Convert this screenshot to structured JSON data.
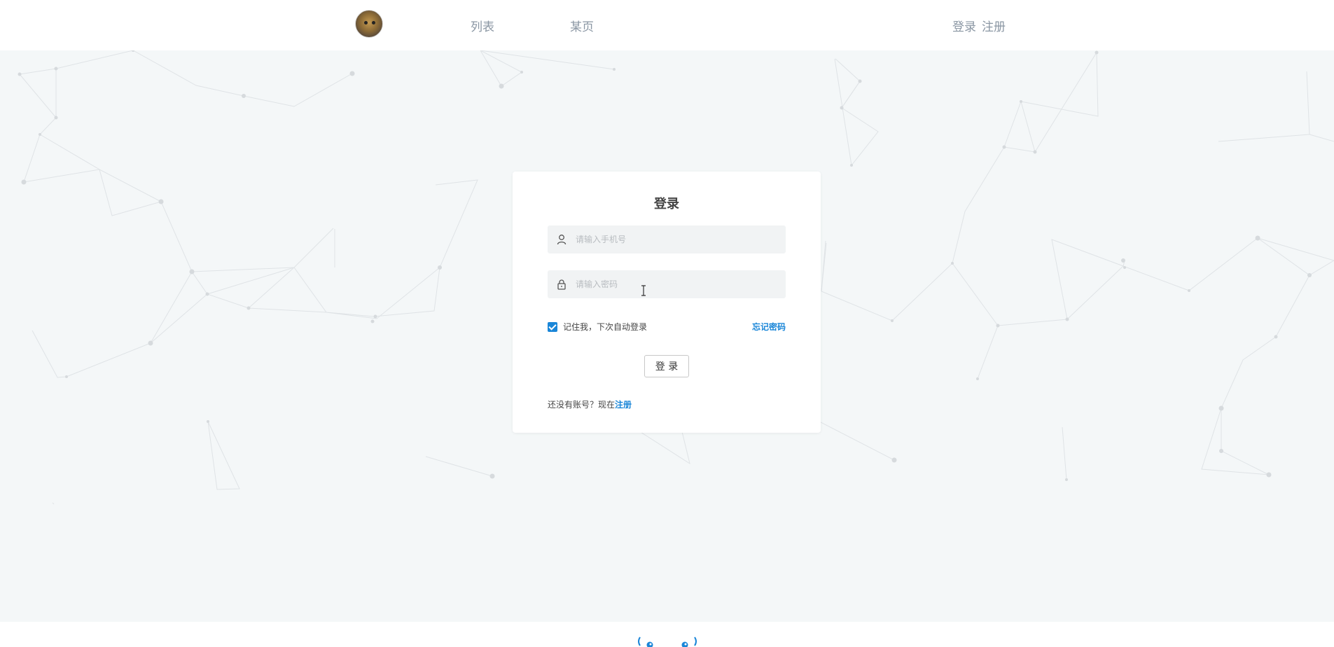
{
  "nav": {
    "links": [
      "列表",
      "某页"
    ],
    "login": "登录",
    "register": "注册"
  },
  "login_form": {
    "title": "登录",
    "phone_placeholder": "请输入手机号",
    "password_placeholder": "请输入密码",
    "remember_label": "记住我，下次自动登录",
    "remember_checked": true,
    "forgot_label": "忘记密码",
    "submit_label": "登 录",
    "no_account_text": "还没有账号？现在",
    "register_link": "注册"
  },
  "colors": {
    "accent": "#1a86d8",
    "nav_text": "#8a96a3",
    "background": "#f4f7f8"
  },
  "icons": [
    "user-icon",
    "lock-icon",
    "text-cursor-icon"
  ]
}
